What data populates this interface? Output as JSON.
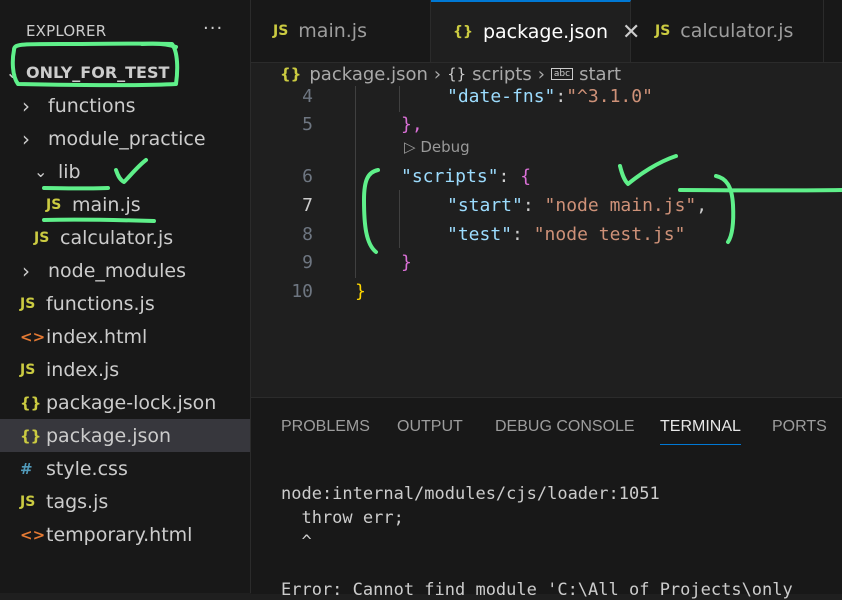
{
  "explorer": {
    "title": "EXPLORER",
    "more": "···",
    "root": "ONLY_FOR_TEST",
    "items": [
      {
        "label": "functions",
        "kind": "folder",
        "icon": "chevron-right-icon"
      },
      {
        "label": "module_practice",
        "kind": "folder",
        "icon": "chevron-right-icon"
      },
      {
        "label": "lib",
        "kind": "folder",
        "icon": "chevron-down-icon"
      },
      {
        "label": "main.js",
        "kind": "js",
        "icon": "js-file-icon",
        "icon_text": "JS"
      },
      {
        "label": "calculator.js",
        "kind": "js",
        "icon": "js-file-icon",
        "icon_text": "JS"
      },
      {
        "label": "node_modules",
        "kind": "folder",
        "icon": "chevron-right-icon"
      },
      {
        "label": "functions.js",
        "kind": "js",
        "icon": "js-file-icon",
        "icon_text": "JS"
      },
      {
        "label": "index.html",
        "kind": "html",
        "icon": "html-file-icon",
        "icon_text": "<>"
      },
      {
        "label": "index.js",
        "kind": "js",
        "icon": "js-file-icon",
        "icon_text": "JS"
      },
      {
        "label": "package-lock.json",
        "kind": "json",
        "icon": "json-file-icon",
        "icon_text": "{}"
      },
      {
        "label": "package.json",
        "kind": "json",
        "icon": "json-file-icon",
        "icon_text": "{}",
        "selected": true
      },
      {
        "label": "style.css",
        "kind": "css",
        "icon": "css-file-icon",
        "icon_text": "#"
      },
      {
        "label": "tags.js",
        "kind": "js",
        "icon": "js-file-icon",
        "icon_text": "JS"
      },
      {
        "label": "temporary.html",
        "kind": "html",
        "icon": "html-file-icon",
        "icon_text": "<>"
      }
    ]
  },
  "tabs": [
    {
      "label": "main.js",
      "icon_text": "JS",
      "active": false
    },
    {
      "label": "package.json",
      "icon_text": "{}",
      "active": true,
      "close": "✕"
    },
    {
      "label": "calculator.js",
      "icon_text": "JS",
      "active": false
    }
  ],
  "breadcrumb": {
    "file": "package.json",
    "symbol1": "scripts",
    "symbol2": "start",
    "sep": "›",
    "json_icon_text": "{}",
    "object_icon_text": "{}",
    "string_icon_text": "abc"
  },
  "editor": {
    "codelens": "Debug",
    "codelens_icon": "▷",
    "lines": [
      {
        "num": "4",
        "text": "\"date-fns\":\"^3.1.0\""
      },
      {
        "num": "5",
        "text": "},"
      },
      {
        "num": "6",
        "text": "\"scripts\": {"
      },
      {
        "num": "7",
        "text": "\"start\": \"node main.js\","
      },
      {
        "num": "8",
        "text": "\"test\": \"node test.js\""
      },
      {
        "num": "9",
        "text": "}"
      },
      {
        "num": "10",
        "text": "}"
      }
    ],
    "tokens": {
      "l4_key": "\"date-fns\"",
      "l4_colon": ":",
      "l4_val": "\"^3.1.0\"",
      "l5": "},",
      "l6_key": "\"scripts\"",
      "l6_colon": ": ",
      "l6_brace": "{",
      "l7_key": "\"start\"",
      "l7_colon": ": ",
      "l7_val": "\"node main.js\"",
      "l7_comma": ",",
      "l8_key": "\"test\"",
      "l8_colon": ": ",
      "l8_val": "\"node test.js\"",
      "l9": "}",
      "l10": "}"
    }
  },
  "panel": {
    "tabs": [
      "PROBLEMS",
      "OUTPUT",
      "DEBUG CONSOLE",
      "TERMINAL",
      "PORTS"
    ],
    "active_tab": "TERMINAL",
    "terminal_lines": [
      "node:internal/modules/cjs/loader:1051",
      "  throw err;",
      "  ^",
      "",
      "Error: Cannot find module 'C:\\All of Projects\\only"
    ]
  },
  "colors": {
    "annotation": "#5ff08a",
    "accent": "#0078d4",
    "js_icon": "#cbcb41",
    "html_icon": "#e37933",
    "css_icon": "#519aba"
  }
}
